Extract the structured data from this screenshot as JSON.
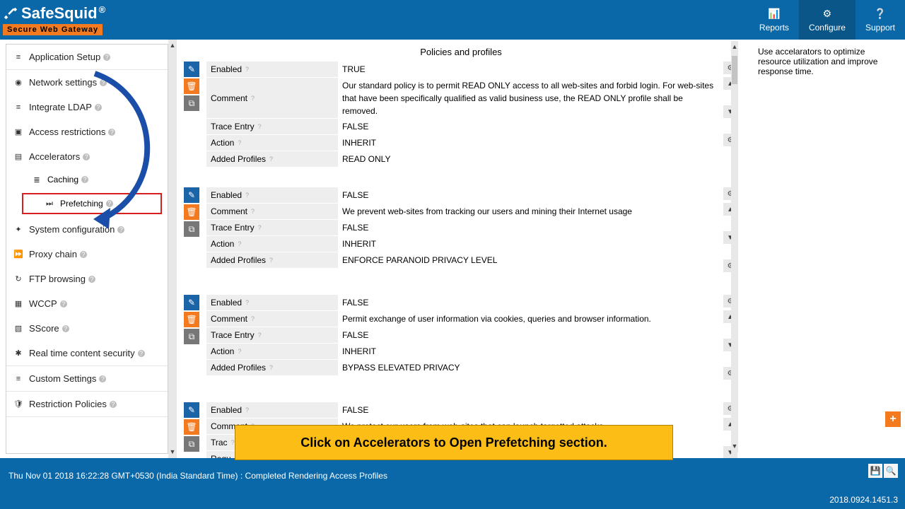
{
  "brand": {
    "name": "SafeSquid",
    "reg": "®",
    "tagline": "Secure Web Gateway"
  },
  "topnav": {
    "reports": "Reports",
    "configure": "Configure",
    "support": "Support"
  },
  "sidebar": {
    "app_setup": "Application Setup",
    "items": [
      "Network settings",
      "Integrate LDAP",
      "Access restrictions",
      "Accelerators"
    ],
    "accel_sub": [
      "Caching",
      "Prefetching"
    ],
    "items2": [
      "System configuration",
      "Proxy chain",
      "FTP browsing",
      "WCCP",
      "SScore"
    ],
    "rtc": "Real time content security",
    "custom": "Custom Settings",
    "restriction": "Restriction Policies"
  },
  "page_title": "Policies and profiles",
  "help_text": "Use accelarators to optimize resource utilization and improve response time.",
  "blocks": [
    {
      "rows": [
        {
          "label": "Enabled",
          "val": "TRUE"
        },
        {
          "label": "Comment",
          "val": "Our standard policy is to permit READ ONLY access to all web-sites and forbid login. For web-sites that have been specifically qualified as valid business use, the READ ONLY profile shall be removed."
        },
        {
          "label": "Trace Entry",
          "val": "FALSE"
        },
        {
          "label": "Action",
          "val": "INHERIT"
        },
        {
          "label": "Added Profiles",
          "val": "READ ONLY"
        }
      ]
    },
    {
      "rows": [
        {
          "label": "Enabled",
          "val": "FALSE"
        },
        {
          "label": "Comment",
          "val": "We prevent web-sites from tracking our users and mining their Internet usage"
        },
        {
          "label": "Trace Entry",
          "val": "FALSE"
        },
        {
          "label": "Action",
          "val": "INHERIT"
        },
        {
          "label": "Added Profiles",
          "val": "ENFORCE PARANOID PRIVACY LEVEL"
        }
      ]
    },
    {
      "rows": [
        {
          "label": "Enabled",
          "val": "FALSE"
        },
        {
          "label": "Comment",
          "val": "Permit exchange of user information via cookies, queries and browser information."
        },
        {
          "label": "Trace Entry",
          "val": "FALSE"
        },
        {
          "label": "Action",
          "val": "INHERIT"
        },
        {
          "label": "Added Profiles",
          "val": "BYPASS ELEVATED PRIVACY"
        }
      ]
    },
    {
      "rows": [
        {
          "label": "Enabled",
          "val": "FALSE"
        },
        {
          "label": "Comment",
          "val": "We protect our users from web-sites that can launch targetted attacks"
        },
        {
          "label": "Trac",
          "val": ""
        },
        {
          "label": "Requ",
          "val": ""
        }
      ]
    }
  ],
  "callout_text": "Click on Accelerators to Open Prefetching section.",
  "footer_status": "Thu Nov 01 2018 16:22:28 GMT+0530 (India Standard Time) : Completed Rendering Access Profiles",
  "version": "2018.0924.1451.3",
  "icons": {
    "gear": "⚙",
    "up": "▲",
    "down": "▼"
  }
}
